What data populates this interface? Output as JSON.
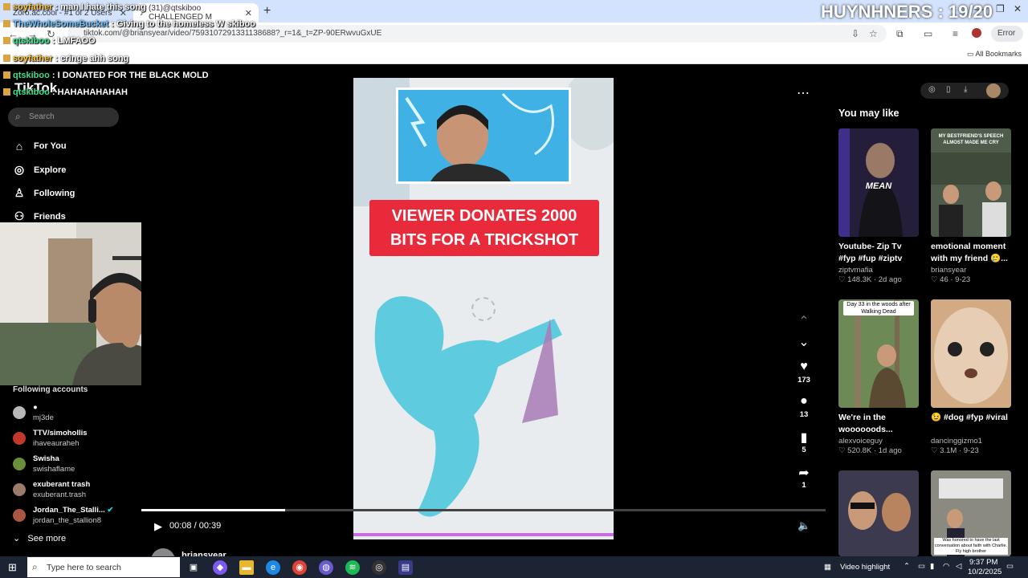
{
  "browser": {
    "tabs": [
      {
        "title": "Zoro.ac.cool - #1 of 2 Users"
      },
      {
        "title": "(31)@qtskiboo CHALLENGED M"
      }
    ],
    "url": "tiktok.com/@briansyear/video/7593107291331138688?_r=1&_t=ZP-90ERwvuGxUE",
    "error_label": "Error",
    "all_bookmarks": "All Bookmarks"
  },
  "overlay": {
    "counter": "HUYNHNERS : 19/20",
    "chat": [
      {
        "user": "soyfather",
        "msg": " : man I hate this song",
        "color": "y"
      },
      {
        "user": "TheWholeSomeBucket",
        "msg": " : Giving to the homeless W skiboo",
        "color": "b"
      },
      {
        "user": "qtskiboo",
        "msg": " : LMFAOO",
        "color": "g"
      },
      {
        "user": "soyfather",
        "msg": " : cringe ahh song",
        "color": "y"
      },
      {
        "user": "qtskiboo",
        "msg": " : I DONATED FOR THE BLACK MOLD",
        "color": "g"
      },
      {
        "user": "qtskiboo",
        "msg": " : HAHAHAHAHAH",
        "color": "g"
      }
    ]
  },
  "tiktok": {
    "logo": "TikTok",
    "search_placeholder": "Search",
    "nav": [
      "For You",
      "Explore",
      "Following",
      "Friends"
    ],
    "following_header": "Following accounts",
    "accounts": [
      {
        "name": "●",
        "handle": "mj3de",
        "color": "#b8b8b8"
      },
      {
        "name": "TTV/simohollis",
        "handle": "ihaveauraheh",
        "color": "#c0392b"
      },
      {
        "name": "Swisha",
        "handle": "swishaflame",
        "color": "#6a8f3a"
      },
      {
        "name": "exuberant trash",
        "handle": "exuberant.trash",
        "color": "#9b7b6a"
      },
      {
        "name": "Jordan_The_Stalli...",
        "handle": "jordan_the_stallion8",
        "color": "#aa5544"
      }
    ],
    "see_more": "See more"
  },
  "video": {
    "banner_line1": "VIEWER DONATES 2000",
    "banner_line2": "BITS FOR A TRICKSHOT",
    "time": "00:08 / 00:39",
    "progress": 0.21,
    "author": "briansyear",
    "likes": "173",
    "comments": "13",
    "saves": "5",
    "shares": "1"
  },
  "you_may_like": {
    "header": "You may like",
    "cards": [
      {
        "title": "Youtube- Zip Tv #fyp #fup #ziptv #funny...",
        "author": "ziptvmafia",
        "stats": "♡ 148.3K · 2d ago",
        "bg": "#2a2440",
        "overlay": "MEAN"
      },
      {
        "title": "emotional moment with my friend 🥲...",
        "author": "briansyear",
        "stats": "♡ 46 · 9-23",
        "bg": "#5a6b5a",
        "overlay": "MY BESTFRIEND'S SPEECH ALMOST MADE ME CRY"
      },
      {
        "title": "We're in the woooooods...",
        "author": "alexvoiceguy",
        "stats": "♡ 520.8K · 1d ago",
        "bg": "#5d7a4a",
        "overlay": "Day 33 in the woods after Walking Dead"
      },
      {
        "title": "😉 #dog #fyp #viral",
        "author": "dancinggizmo1",
        "stats": "♡ 3.1M · 9-23",
        "bg": "#c8a27a",
        "overlay": ""
      },
      {
        "title": "",
        "author": "",
        "stats": "",
        "bg": "#3d4a6a",
        "overlay": ""
      },
      {
        "title": "",
        "author": "",
        "stats": "",
        "bg": "#7a7a70",
        "overlay": "Was honored to have the last conversation about faith with Charlie. Fly high brother"
      }
    ]
  },
  "taskbar": {
    "search_placeholder": "Type here to search",
    "video_highlight": "Video highlight",
    "time": "9:37 PM",
    "date": "10/2/2025"
  },
  "colors": {
    "accent_red": "#e82a3a",
    "tiktok_bg": "#000000"
  }
}
